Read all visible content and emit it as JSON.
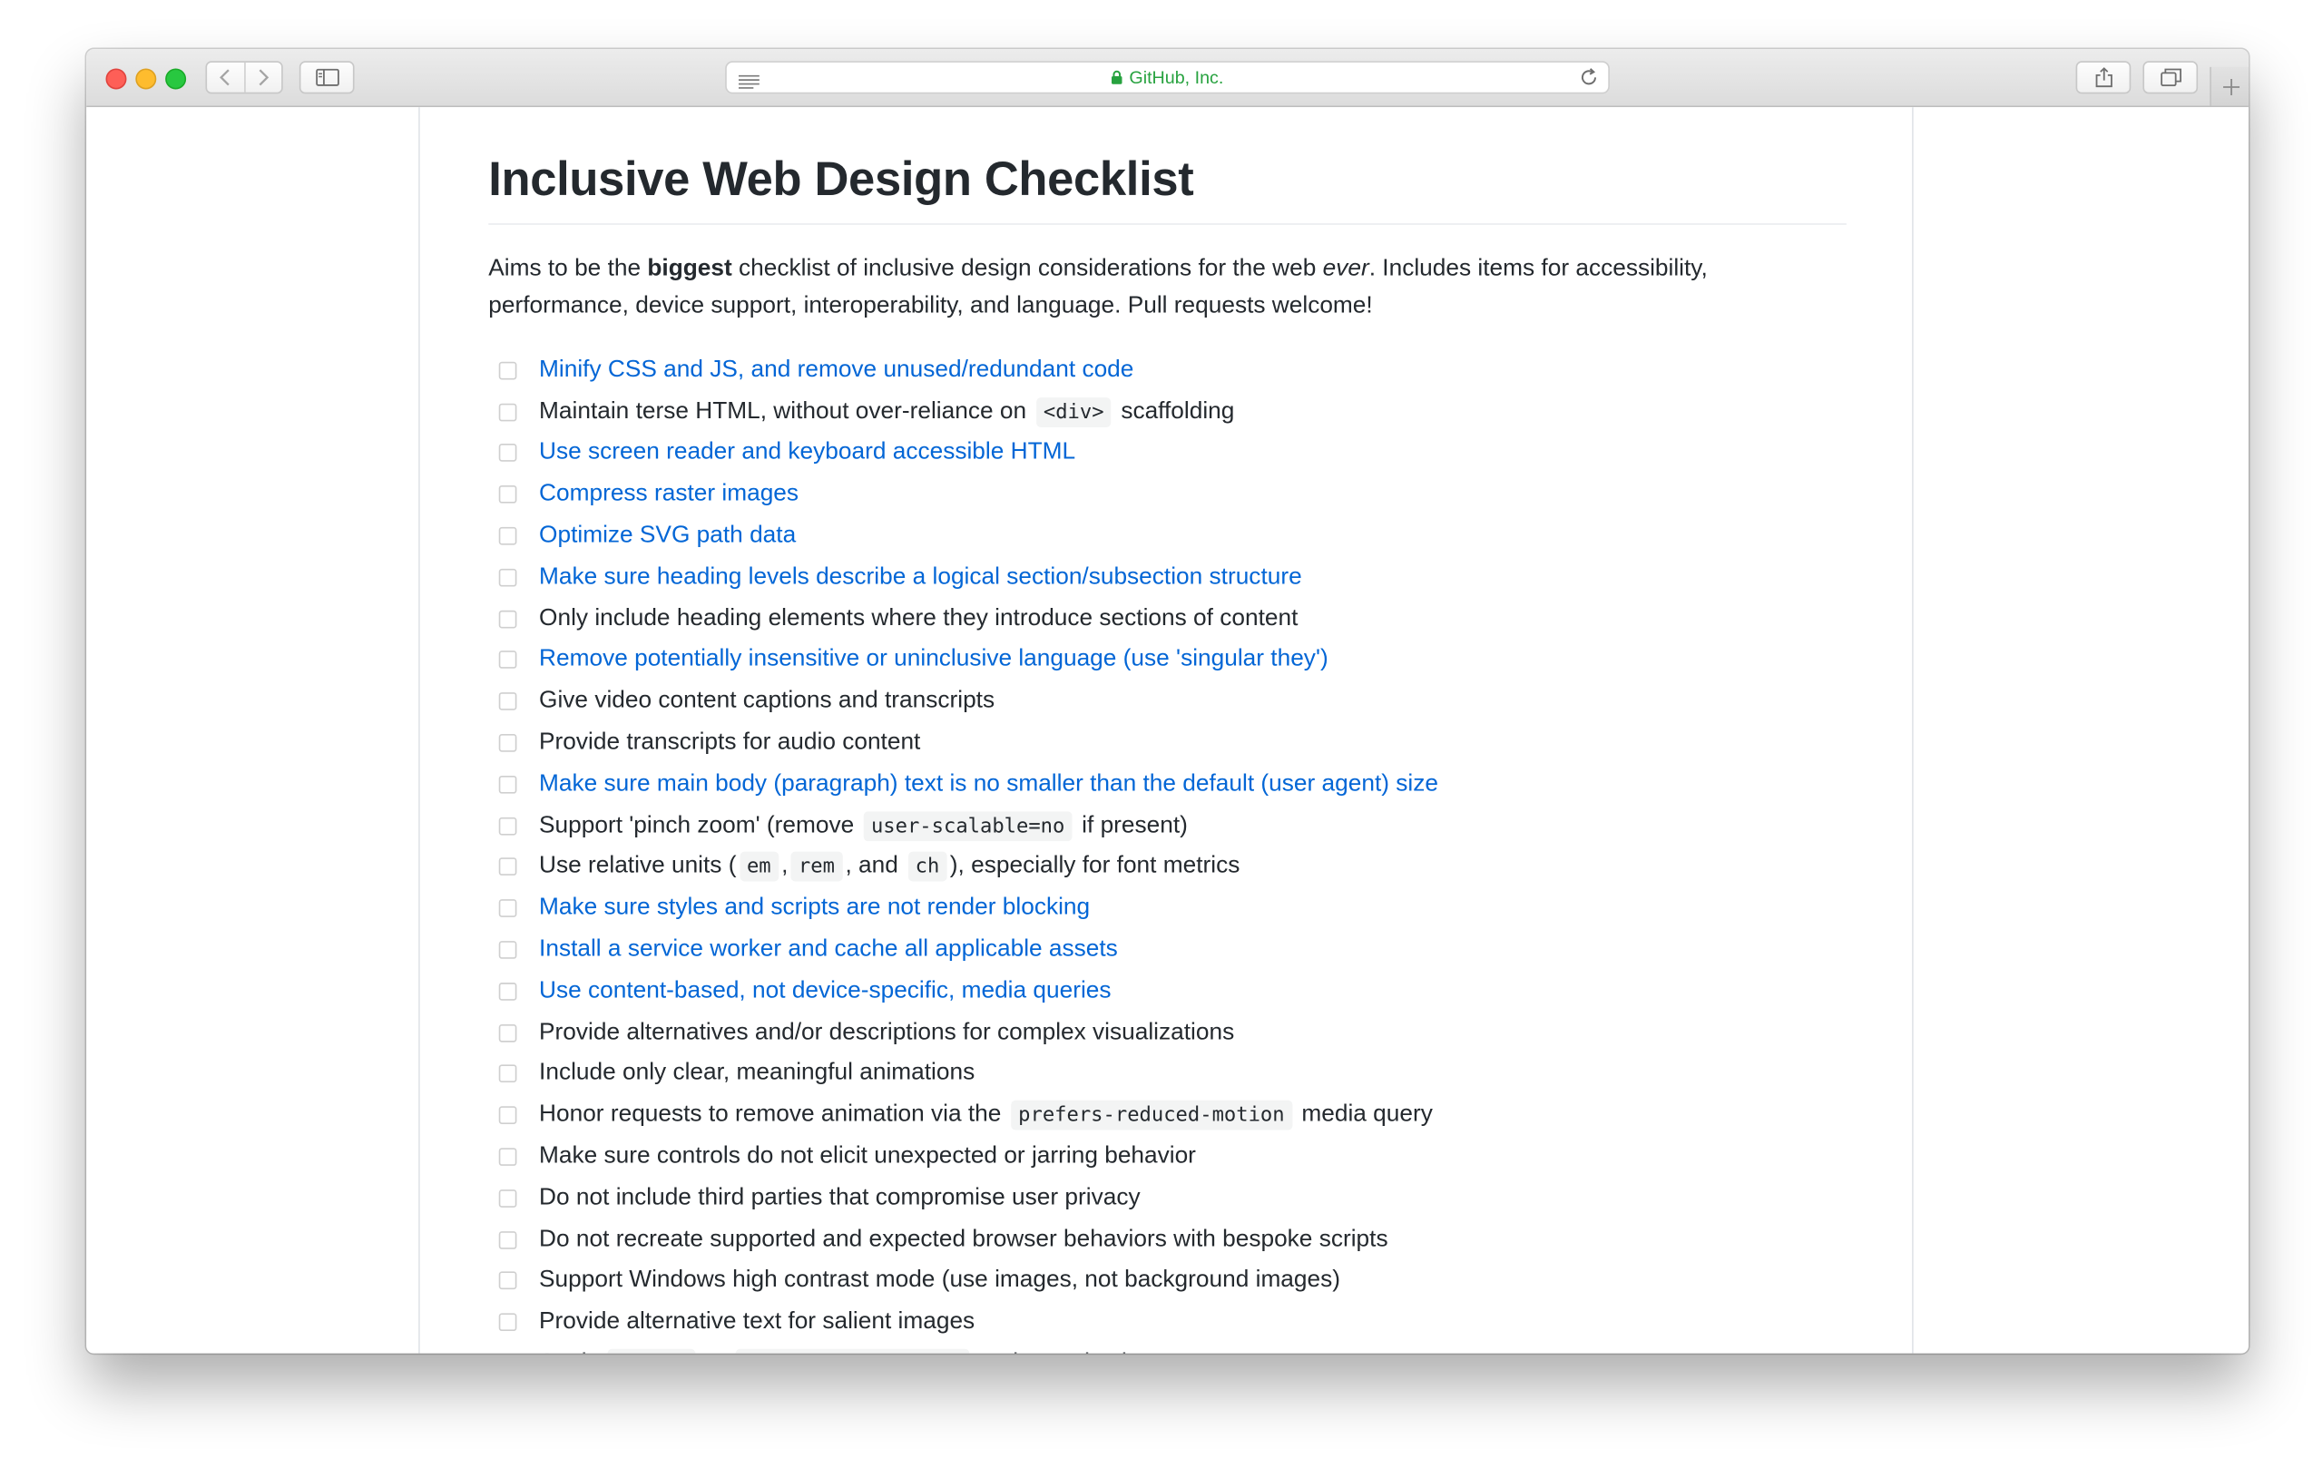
{
  "browser": {
    "address": "GitHub, Inc.",
    "icons": {
      "back": "chevron-left-icon",
      "forward": "chevron-right-icon",
      "sidebar": "sidebar-icon",
      "reader": "reader-list-icon",
      "lock": "lock-icon",
      "reload": "reload-icon",
      "share": "share-icon",
      "tabs": "tabs-overview-icon",
      "new_tab": "plus-icon"
    },
    "colors": {
      "close": "#fe5f57",
      "minimize": "#febc2e",
      "zoom": "#28c840",
      "secure": "#27a23f"
    }
  },
  "page": {
    "title": "Inclusive Web Design Checklist",
    "intro": [
      {
        "text": "Aims to be the "
      },
      {
        "text": "biggest",
        "style": "bold"
      },
      {
        "text": " checklist of inclusive design considerations for the web "
      },
      {
        "text": "ever",
        "style": "italic"
      },
      {
        "text": ". Includes items for accessibility, performance, device support, interoperability, and language. Pull requests welcome!"
      }
    ],
    "colors": {
      "text": "#24292e",
      "link": "#0366d6"
    },
    "checklist": [
      {
        "checked": false,
        "link": true,
        "parts": [
          {
            "text": "Minify CSS and JS, and remove unused/redundant code"
          }
        ]
      },
      {
        "checked": false,
        "link": false,
        "parts": [
          {
            "text": "Maintain terse HTML, without over-reliance on "
          },
          {
            "code": "<div>"
          },
          {
            "text": " scaffolding"
          }
        ]
      },
      {
        "checked": false,
        "link": true,
        "parts": [
          {
            "text": "Use screen reader and keyboard accessible HTML"
          }
        ]
      },
      {
        "checked": false,
        "link": true,
        "parts": [
          {
            "text": "Compress raster images"
          }
        ]
      },
      {
        "checked": false,
        "link": true,
        "parts": [
          {
            "text": "Optimize SVG path data"
          }
        ]
      },
      {
        "checked": false,
        "link": true,
        "parts": [
          {
            "text": "Make sure heading levels describe a logical section/subsection structure"
          }
        ]
      },
      {
        "checked": false,
        "link": false,
        "parts": [
          {
            "text": "Only include heading elements where they introduce sections of content"
          }
        ]
      },
      {
        "checked": false,
        "link": true,
        "parts": [
          {
            "text": "Remove potentially insensitive or uninclusive language (use 'singular they')"
          }
        ]
      },
      {
        "checked": false,
        "link": false,
        "parts": [
          {
            "text": "Give video content captions and transcripts"
          }
        ]
      },
      {
        "checked": false,
        "link": false,
        "parts": [
          {
            "text": "Provide transcripts for audio content"
          }
        ]
      },
      {
        "checked": false,
        "link": true,
        "parts": [
          {
            "text": "Make sure main body (paragraph) text is no smaller than the default (user agent) size"
          }
        ]
      },
      {
        "checked": false,
        "link": false,
        "parts": [
          {
            "text": "Support 'pinch zoom' (remove "
          },
          {
            "code": "user-scalable=no"
          },
          {
            "text": " if present)"
          }
        ]
      },
      {
        "checked": false,
        "link": false,
        "parts": [
          {
            "text": "Use relative units ("
          },
          {
            "code": "em"
          },
          {
            "text": ","
          },
          {
            "code": "rem"
          },
          {
            "text": ", and "
          },
          {
            "code": "ch"
          },
          {
            "text": "), especially for font metrics"
          }
        ]
      },
      {
        "checked": false,
        "link": true,
        "parts": [
          {
            "text": "Make sure styles and scripts are not render blocking"
          }
        ]
      },
      {
        "checked": false,
        "link": true,
        "parts": [
          {
            "text": "Install a service worker and cache all applicable assets"
          }
        ]
      },
      {
        "checked": false,
        "link": true,
        "parts": [
          {
            "text": "Use content-based, not device-specific, media queries"
          }
        ]
      },
      {
        "checked": false,
        "link": false,
        "parts": [
          {
            "text": "Provide alternatives and/or descriptions for complex visualizations"
          }
        ]
      },
      {
        "checked": false,
        "link": false,
        "parts": [
          {
            "text": "Include only clear, meaningful animations"
          }
        ]
      },
      {
        "checked": false,
        "link": false,
        "parts": [
          {
            "text": "Honor requests to remove animation via the "
          },
          {
            "code": "prefers-reduced-motion"
          },
          {
            "text": " media query"
          }
        ]
      },
      {
        "checked": false,
        "link": false,
        "parts": [
          {
            "text": "Make sure controls do not elicit unexpected or jarring behavior"
          }
        ]
      },
      {
        "checked": false,
        "link": false,
        "parts": [
          {
            "text": "Do not include third parties that compromise user privacy"
          }
        ]
      },
      {
        "checked": false,
        "link": false,
        "parts": [
          {
            "text": "Do not recreate supported and expected browser behaviors with bespoke scripts"
          }
        ]
      },
      {
        "checked": false,
        "link": false,
        "parts": [
          {
            "text": "Support Windows high contrast mode (use images, not background images)"
          }
        ]
      },
      {
        "checked": false,
        "link": false,
        "parts": [
          {
            "text": "Provide alternative text for salient images"
          }
        ]
      },
      {
        "checked": false,
        "link": false,
        "parts": [
          {
            "text": "Apply "
          },
          {
            "code": "alt=\"\""
          },
          {
            "text": " or "
          },
          {
            "code": "aria-hidden=\"true\""
          },
          {
            "text": " to decorative images"
          }
        ]
      }
    ]
  }
}
